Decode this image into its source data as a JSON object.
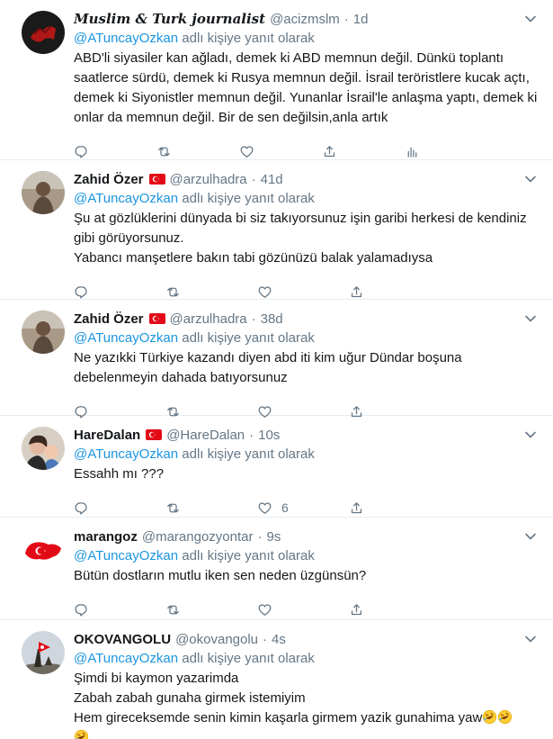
{
  "colors": {
    "link": "#1b95e0",
    "muted": "#657786",
    "text": "#14171a",
    "divider": "#e6ecf0"
  },
  "icons": [
    "reply-icon",
    "retweet-icon",
    "like-icon",
    "share-icon",
    "analytics-icon",
    "chevron-down-icon",
    "turkish-flag-icon",
    "rolling-laughing-emoji"
  ],
  "reply_prefix_suffix": "adlı kişiye yanıt olarak",
  "tweets": [
    {
      "name": "Muslim & Turk journalist",
      "handle": "@acizmslm",
      "dot": "·",
      "time": "1d",
      "mention": "@ATuncayOzkan",
      "lines": [
        "ABD'li siyasiler kan ağladı, demek ki ABD memnun değil. Dünkü toplantı",
        "saatlerce sürdü, demek ki Rusya memnun değil. İsrail teröristlere kucak açtı,",
        "demek ki Siyonistler memnun değil. Yunanlar İsrail'le anlaşma yaptı, demek ki",
        "onlar da memnun değil. Bir de sen değilsin,anla artık"
      ]
    },
    {
      "name": "Zahid Özer",
      "handle": "@arzulhadra",
      "dot": "·",
      "time": "41d",
      "mention": "@ATuncayOzkan",
      "lines": [
        "Şu at gözlüklerini dünyada bi siz takıyorsunuz işin garibi herkesi de kendiniz",
        "gibi görüyorsunuz.",
        "Yabancı manşetlere bakın tabi gözünüzü balak yalamadıysa"
      ]
    },
    {
      "name": "Zahid Özer",
      "handle": "@arzulhadra",
      "dot": "·",
      "time": "38d",
      "mention": "@ATuncayOzkan",
      "lines": [
        "Ne yazıkki Türkiye kazandı diyen abd iti kim uğur Dündar boşuna",
        "debelenmeyin dahada batıyorsunuz"
      ]
    },
    {
      "name": "HareDalan",
      "handle": "@HareDalan",
      "dot": "·",
      "time": "10s",
      "mention": "@ATuncayOzkan",
      "lines": [
        "Essahh mı  ???"
      ],
      "like_count": "6"
    },
    {
      "name": "marangoz",
      "handle": "@marangozyontar",
      "dot": "·",
      "time": "9s",
      "mention": "@ATuncayOzkan",
      "lines": [
        "Bütün dostların mutlu iken sen neden üzgünsün?"
      ]
    },
    {
      "name": "OKOVANGOLU",
      "handle": "@okovangolu",
      "dot": "·",
      "time": "4s",
      "mention": "@ATuncayOzkan",
      "lines": [
        "Şimdi bi kaymon yazarimda",
        "Zabah zabah gunaha girmek istemiyim",
        "Hem gireceksemde senin kimin kaşarla girmem yazik gunahima yaw"
      ]
    }
  ]
}
